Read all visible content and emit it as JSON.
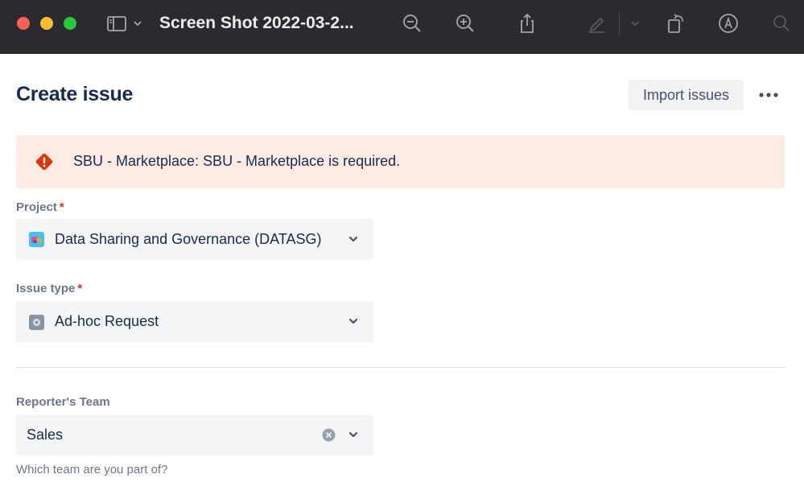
{
  "window": {
    "title": "Screen Shot 2022-03-2..."
  },
  "toolbar": {
    "icons": [
      "sidebar-icon",
      "chevron-down-icon",
      "zoom-out-icon",
      "zoom-in-icon",
      "share-icon",
      "markup-icon",
      "chevron-down-icon",
      "rotate-icon",
      "annotate-icon",
      "search-icon"
    ]
  },
  "header": {
    "title": "Create issue",
    "import_label": "Import issues"
  },
  "error": {
    "message": "SBU - Marketplace: SBU - Marketplace is required.",
    "color": "#ffebe6",
    "icon": "error-icon"
  },
  "fields": {
    "project": {
      "label": "Project",
      "required_mark": "*",
      "value": "Data Sharing and Governance (DATASG)"
    },
    "issue_type": {
      "label": "Issue type",
      "required_mark": "*",
      "value": "Ad-hoc Request"
    },
    "reporters_team": {
      "label": "Reporter's Team",
      "value": "Sales",
      "helper": "Which team are you part of?"
    }
  },
  "colors": {
    "title_bar": "#2b2a2e",
    "required": "#de350b",
    "field_bg": "#f4f5f7",
    "text": "#172b4d"
  }
}
